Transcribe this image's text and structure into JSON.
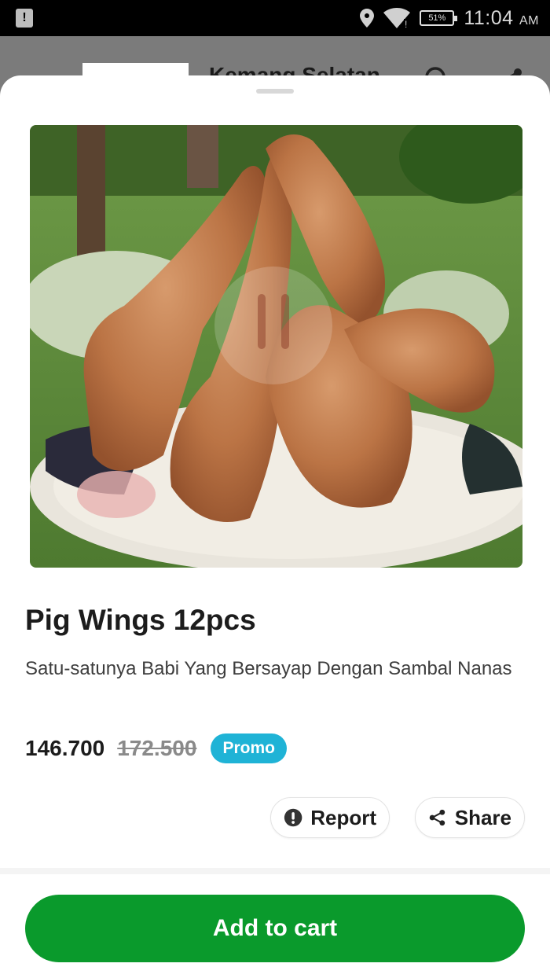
{
  "status_bar": {
    "battery": "51%",
    "time": "11:04",
    "ampm": "AM"
  },
  "background_header": {
    "title": "Kemang Selatan"
  },
  "product": {
    "name": "Pig Wings 12pcs",
    "description": "Satu-satunya Babi Yang Bersayap Dengan Sambal Nanas",
    "price": "146.700",
    "original_price": "172.500",
    "badge": "Promo"
  },
  "actions": {
    "report_label": "Report",
    "share_label": "Share",
    "add_to_cart_label": "Add to cart"
  },
  "colors": {
    "primary_green": "#0a9a2c",
    "promo_blue": "#1fb3d6"
  }
}
